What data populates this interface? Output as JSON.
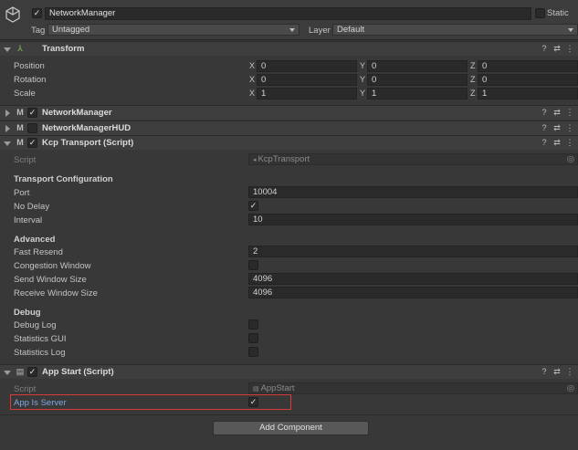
{
  "object": {
    "name": "NetworkManager",
    "active_check": "✓",
    "static_label": "Static",
    "tag_label": "Tag",
    "tag_value": "Untagged",
    "layer_label": "Layer",
    "layer_value": "Default"
  },
  "transform": {
    "title": "Transform",
    "rows": [
      {
        "label": "Position",
        "x": "0",
        "y": "0",
        "z": "0"
      },
      {
        "label": "Rotation",
        "x": "0",
        "y": "0",
        "z": "0"
      },
      {
        "label": "Scale",
        "x": "1",
        "y": "1",
        "z": "1"
      }
    ],
    "axis_x": "X",
    "axis_y": "Y",
    "axis_z": "Z"
  },
  "components": {
    "network_manager": {
      "title": "NetworkManager",
      "check": "✓"
    },
    "network_manager_hud": {
      "title": "NetworkManagerHUD",
      "check": ""
    },
    "kcp": {
      "title": "Kcp Transport (Script)",
      "check": "✓"
    }
  },
  "kcp": {
    "script_label": "Script",
    "script_value": "KcpTransport",
    "section_transport": "Transport Configuration",
    "port_label": "Port",
    "port_value": "10004",
    "nodelay_label": "No Delay",
    "nodelay_check": "✓",
    "interval_label": "Interval",
    "interval_value": "10",
    "section_advanced": "Advanced",
    "fastresend_label": "Fast Resend",
    "fastresend_value": "2",
    "congestion_label": "Congestion Window",
    "sendwin_label": "Send Window Size",
    "sendwin_value": "4096",
    "recvwin_label": "Receive Window Size",
    "recvwin_value": "4096",
    "section_debug": "Debug",
    "debuglog_label": "Debug Log",
    "statsgui_label": "Statistics GUI",
    "statslog_label": "Statistics Log"
  },
  "appstart": {
    "title": "App Start (Script)",
    "check": "✓",
    "script_label": "Script",
    "script_value": "AppStart",
    "server_label": "App Is Server",
    "server_check": "✓"
  },
  "add_component": "Add Component",
  "icons": {
    "help": "?",
    "preset": "⇄",
    "menu": "⋮"
  },
  "colors": {
    "highlight_border": "#d83a3a",
    "server_label": "#7fa7e0"
  }
}
